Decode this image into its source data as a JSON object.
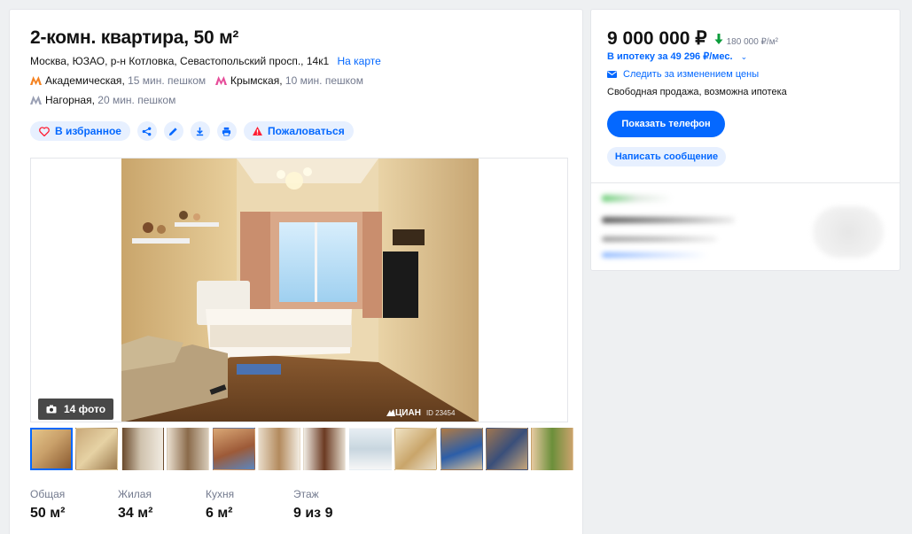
{
  "listing": {
    "title": "2-комн. квартира, 50 м²",
    "address": "Москва, ЮЗАО, р-н Котловка, Севастопольский просп., 14к1",
    "map_link": "На карте",
    "metro": [
      {
        "name": "Академическая",
        "walk": "15 мин. пешком",
        "color": "#f58220"
      },
      {
        "name": "Крымская",
        "walk": "10 мин. пешком",
        "color": "#e64d9a"
      },
      {
        "name": "Нагорная",
        "walk": "20 мин. пешком",
        "color": "#9aa0b4"
      }
    ]
  },
  "actions": {
    "favorite": "В избранное",
    "complain": "Пожаловаться"
  },
  "gallery": {
    "photo_count": "14 фото",
    "watermark_brand": "ЦИАН",
    "watermark_id": "ID 23454",
    "thumbnail_count": 12
  },
  "specs": [
    {
      "label": "Общая",
      "value": "50 м²"
    },
    {
      "label": "Жилая",
      "value": "34 м²"
    },
    {
      "label": "Кухня",
      "value": "6 м²"
    },
    {
      "label": "Этаж",
      "value": "9 из 9"
    }
  ],
  "sidebar": {
    "price": "9 000 000 ₽",
    "price_per_m2": "180 000 ₽/м²",
    "mortgage": "В ипотеку за 49 296 ₽/мес.",
    "track_price": "Следить за изменением цены",
    "sale_type": "Свободная продажа, возможна ипотека",
    "show_phone": "Показать телефон",
    "write_message": "Написать сообщение"
  },
  "colors": {
    "accent": "#0468ff",
    "accent_light": "#e7f0ff",
    "price_down": "#0c9c3c",
    "danger": "#ff1f34"
  }
}
